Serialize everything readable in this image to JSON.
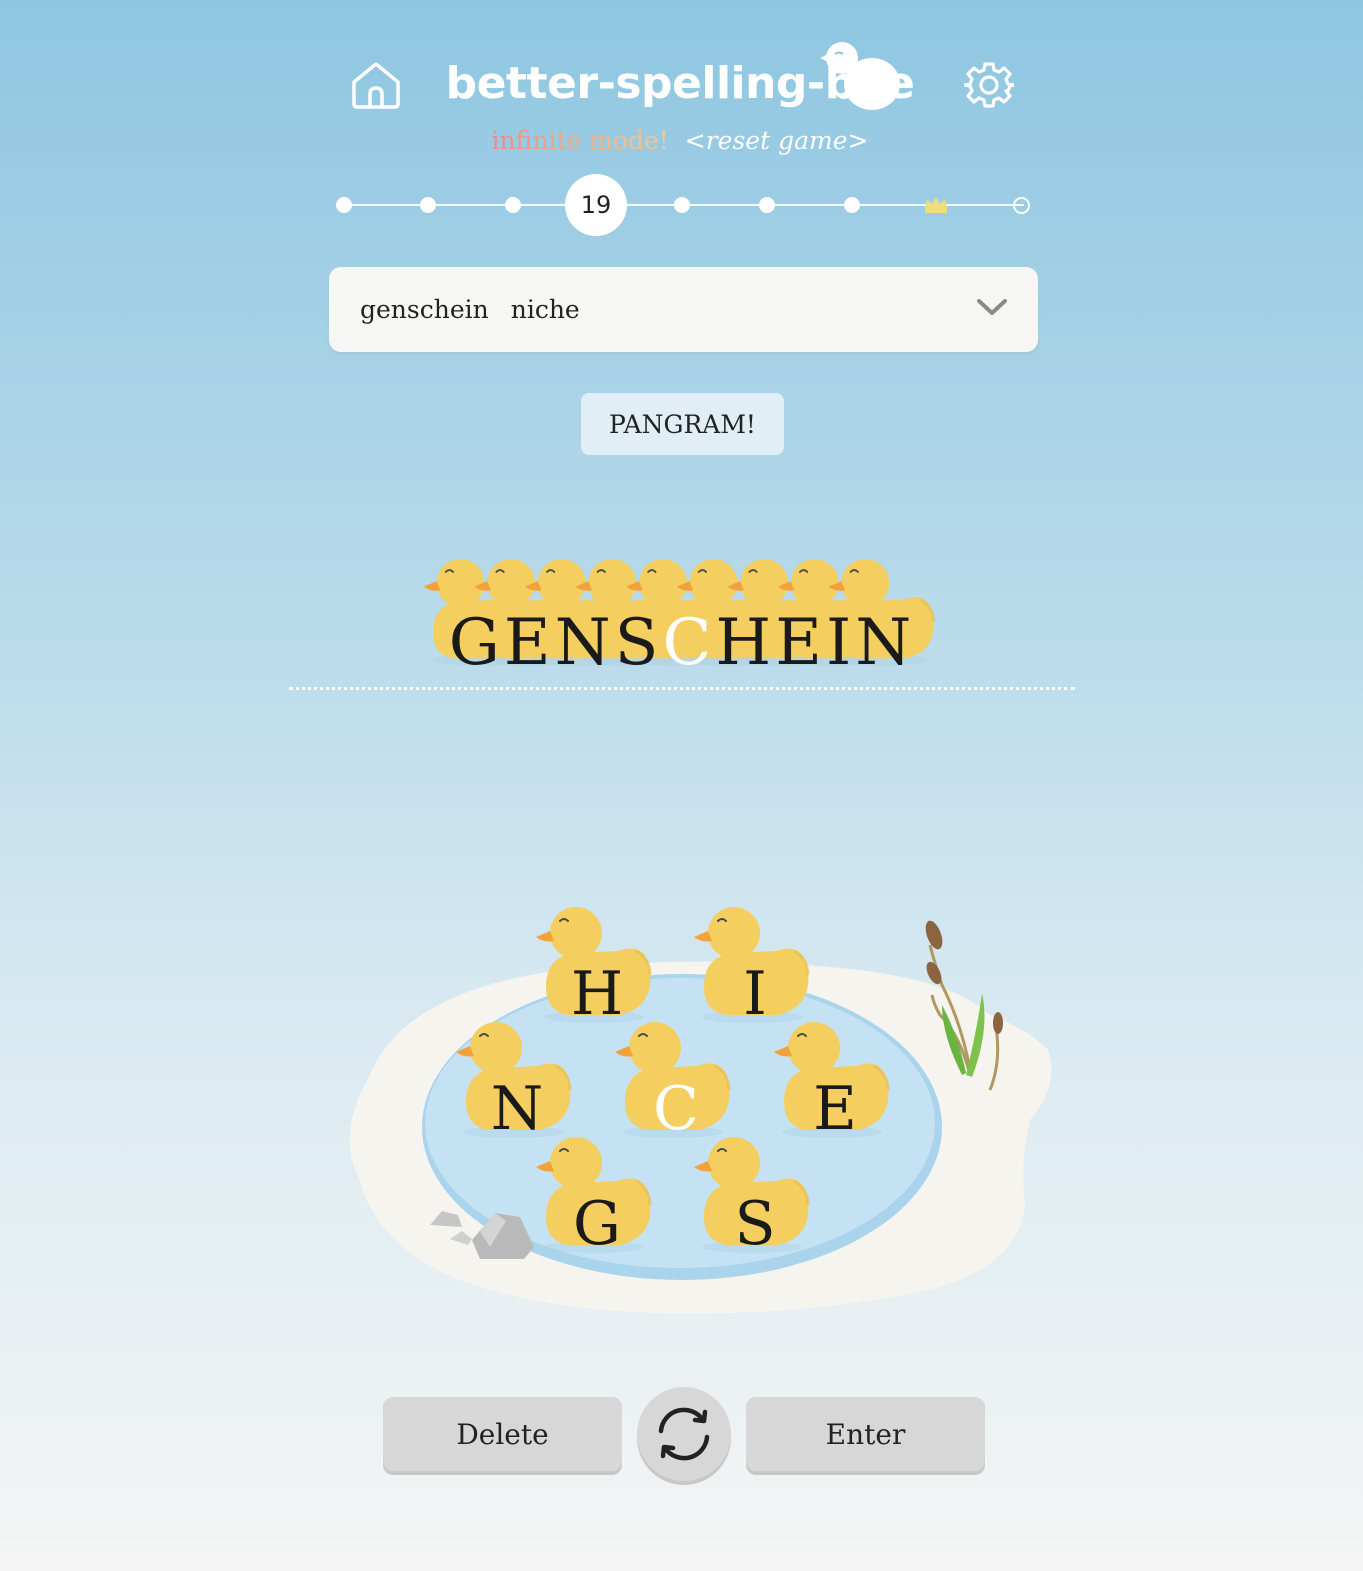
{
  "header": {
    "title": "better-spelling-bee",
    "mode_label": "infinite mode!",
    "reset_label": "<reset game>",
    "home_icon": "home-icon",
    "settings_icon": "gear-icon"
  },
  "progress": {
    "score": "19",
    "levels_total": 9,
    "current_level_index": 3,
    "crown_level_index": 7,
    "final_level_index": 8
  },
  "found_words": {
    "words": [
      "genschein",
      "niche"
    ],
    "expand_icon": "chevron-down-icon"
  },
  "toast": "PANGRAM!",
  "current_word": {
    "letters": [
      "G",
      "E",
      "N",
      "S",
      "C",
      "H",
      "E",
      "I",
      "N"
    ],
    "center_letter": "C"
  },
  "hive": {
    "center": "C",
    "outer": [
      "H",
      "I",
      "N",
      "E",
      "G",
      "S"
    ]
  },
  "buttons": {
    "delete": "Delete",
    "enter": "Enter",
    "shuffle_icon": "shuffle-icon"
  },
  "colors": {
    "duck": "#f4cf5f",
    "beak": "#f3a23a",
    "pond": "#bfe0f2",
    "accent": "#f0b48a"
  }
}
